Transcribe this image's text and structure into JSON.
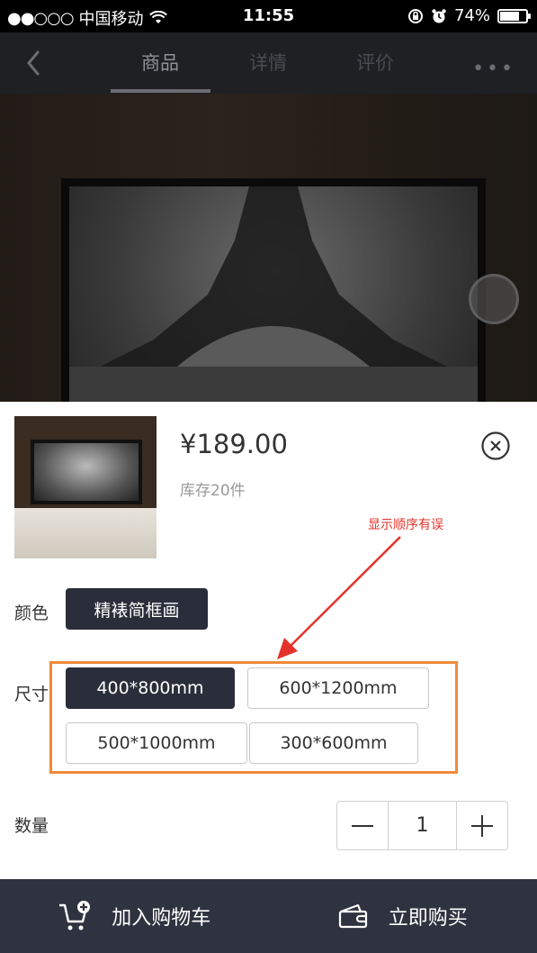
{
  "status_bar": {
    "carrier": "中国移动",
    "time": "11:55",
    "battery": "74%",
    "battery_level": 0.74,
    "icons": [
      "signal-dots-icon",
      "wifi-icon",
      "rotation-lock-icon",
      "alarm-icon",
      "battery-icon"
    ]
  },
  "nav": {
    "tabs": [
      {
        "label": "商品",
        "active": true
      },
      {
        "label": "详情",
        "active": false
      },
      {
        "label": "评价",
        "active": false
      }
    ],
    "more": "•••"
  },
  "product": {
    "price": "¥189.00",
    "stock": "库存20件"
  },
  "annotation": {
    "text": "显示顺序有误",
    "color": "#e4322b",
    "box_color": "#ef8a3a"
  },
  "options": {
    "color_label": "颜色",
    "colors": [
      {
        "label": "精裱简框画",
        "selected": true
      }
    ],
    "size_label": "尺寸",
    "sizes": [
      {
        "label": "400*800mm",
        "selected": true
      },
      {
        "label": "600*1200mm",
        "selected": false
      },
      {
        "label": "500*1000mm",
        "selected": false
      },
      {
        "label": "300*600mm",
        "selected": false
      }
    ],
    "quantity_label": "数量",
    "quantity": "1"
  },
  "actions": {
    "add_to_cart": "加入购物车",
    "buy_now": "立即购买"
  },
  "colors": {
    "nav_bg": "#1f2024",
    "bottom_bar_bg": "#2f3340",
    "selected_chip_bg": "#2a2e3a"
  }
}
